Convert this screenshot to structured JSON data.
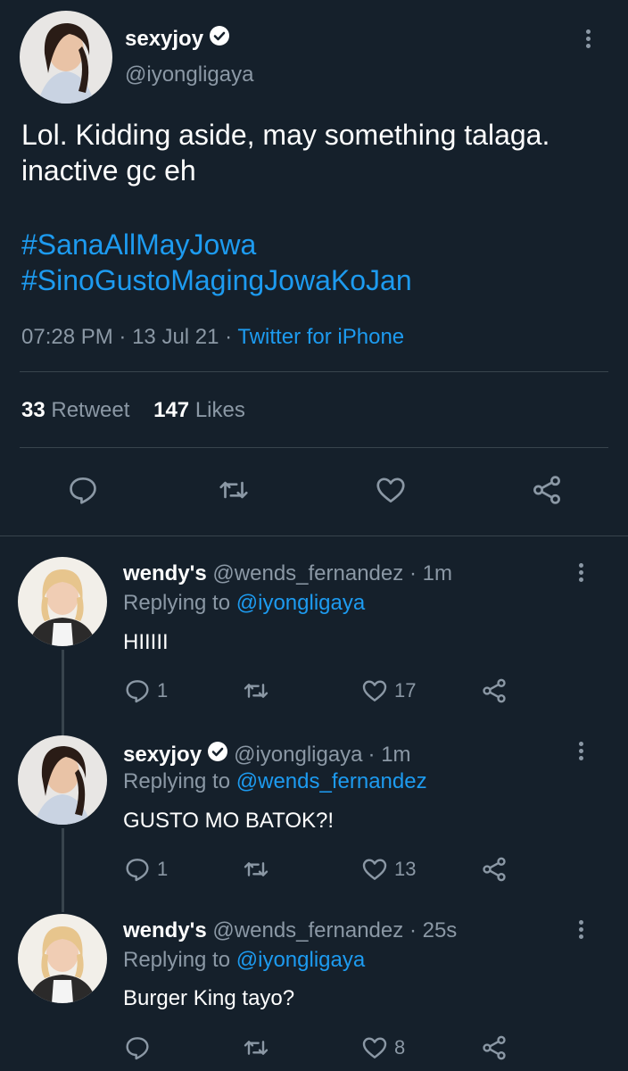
{
  "main_tweet": {
    "display_name": "sexyjoy",
    "handle": "@iyongligaya",
    "text_line1": "Lol. Kidding aside, may something talaga.",
    "text_line2": "inactive gc eh",
    "hashtag1": "#SanaAllMayJowa",
    "hashtag2": "#SinoGustoMagingJowaKoJan",
    "time": "07:28 PM",
    "date": "13 Jul 21",
    "sep1": "·",
    "sep2": "·",
    "source": "Twitter for iPhone",
    "retweet_count": "33",
    "retweet_label": "Retweet",
    "like_count": "147",
    "like_label": "Likes"
  },
  "replies": [
    {
      "display_name": "wendy's",
      "handle": "@wends_fernandez",
      "time": "· 1m",
      "replying_label": "Replying to",
      "replying_to": "@iyongligaya",
      "text": "HIIIII",
      "reply_count": "1",
      "retweet_count": "",
      "like_count": "17"
    },
    {
      "display_name": "sexyjoy",
      "handle": "@iyongligaya",
      "time": "· 1m",
      "replying_label": "Replying to",
      "replying_to": "@wends_fernandez",
      "text": "GUSTO MO BATOK?!",
      "reply_count": "1",
      "retweet_count": "",
      "like_count": "13"
    },
    {
      "display_name": "wendy's",
      "handle": "@wends_fernandez",
      "time": "· 25s",
      "replying_label": "Replying to",
      "replying_to": "@iyongligaya",
      "text": "Burger King tayo?",
      "reply_count": "",
      "retweet_count": "",
      "like_count": "8"
    }
  ],
  "colors": {
    "background": "#15202b",
    "accent": "#1d9bf0",
    "muted": "#8b98a5",
    "divider": "#38444d"
  }
}
